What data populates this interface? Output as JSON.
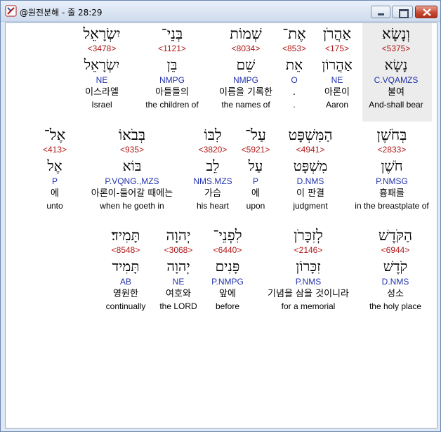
{
  "window": {
    "title": "@원전분해 - 줄 28:29",
    "buttons": {
      "minimize": "minimize",
      "maximize": "maximize",
      "close": "close"
    }
  },
  "rows": [
    [
      {
        "heb": "וְנָשָׂא",
        "num": "<5375>",
        "lemma": "נָשָׂא",
        "morph": "C.VQAMZS",
        "kor": "불여",
        "eng": "And-shall bear"
      },
      {
        "heb": "אַהֲרֹן",
        "num": "<175>",
        "lemma": "אַהֲרוֹן",
        "morph": "NE",
        "kor": "아론이",
        "eng": "Aaron"
      },
      {
        "heb": "אֶת־",
        "num": "<853>",
        "lemma": "אֵת",
        "morph": "O",
        "kor": ".",
        "eng": "."
      },
      {
        "heb": "שְׁמוֹת",
        "num": "<8034>",
        "lemma": "שֵׁם",
        "morph": "NMPG",
        "kor": "이름을 기록한",
        "eng": "the names of"
      },
      {
        "heb": "בְּנֵי־",
        "num": "<1121>",
        "lemma": "בֵּן",
        "morph": "NMPG",
        "kor": "아들들의",
        "eng": "the children of"
      },
      {
        "heb": "יִשְׂרָאֵל",
        "num": "<3478>",
        "lemma": "יִשְׂרָאֵל",
        "morph": "NE",
        "kor": "이스라엘",
        "eng": "Israel"
      }
    ],
    [
      {
        "heb": "בְּחֹשֶׁן",
        "num": "<2833>",
        "lemma": "חֹשֶׁן",
        "morph": "P.NMSG",
        "kor": "흉패를",
        "eng": "in the breastplate of"
      },
      {
        "heb": "הַמִּשְׁפָּט",
        "num": "<4941>",
        "lemma": "מִשְׁפָּט",
        "morph": "D.NMS",
        "kor": "이 판결",
        "eng": "judgment"
      },
      {
        "heb": "עַל־",
        "num": "<5921>",
        "lemma": "עַל",
        "morph": "P",
        "kor": "에",
        "eng": "upon"
      },
      {
        "heb": "לִבּוֹ",
        "num": "<3820>",
        "lemma": "לֵב",
        "morph": "NMS.MZS",
        "kor": "가슴",
        "eng": "his heart"
      },
      {
        "heb": "בְּבֹאוֹ",
        "num": "<935>",
        "lemma": "בּוֹא",
        "morph": "P.VQNG.,MZS",
        "kor": "아론이-들어갈 때에는",
        "eng": "when he goeth in"
      },
      {
        "heb": "אֶל־",
        "num": "<413>",
        "lemma": "אֶל",
        "morph": "P",
        "kor": "에",
        "eng": "unto"
      }
    ],
    [
      {
        "heb": "הַקֹּדֶשׁ",
        "num": "<6944>",
        "lemma": "קֹדֶשׁ",
        "morph": "D.NMS",
        "kor": "성소",
        "eng": "the holy place"
      },
      {
        "heb": "לְזִכָּרֹן",
        "num": "<2146>",
        "lemma": "זִכָּרוֹן",
        "morph": "P.NMS",
        "kor": "기념을 삼을 것이니라",
        "eng": "for a memorial"
      },
      {
        "heb": "לִפְנֵי־",
        "num": "<6440>",
        "lemma": "פָּנִים",
        "morph": "P.NMPG",
        "kor": "앞에",
        "eng": "before"
      },
      {
        "heb": "יְהוָה",
        "num": "<3068>",
        "lemma": "יְהוָה",
        "morph": "NE",
        "kor": "여호와",
        "eng": "the LORD"
      },
      {
        "heb": "תָּמִיד׃",
        "num": "<8548>",
        "lemma": "תָּמִיד",
        "morph": "AB",
        "kor": "영원한",
        "eng": "continually"
      }
    ]
  ]
}
